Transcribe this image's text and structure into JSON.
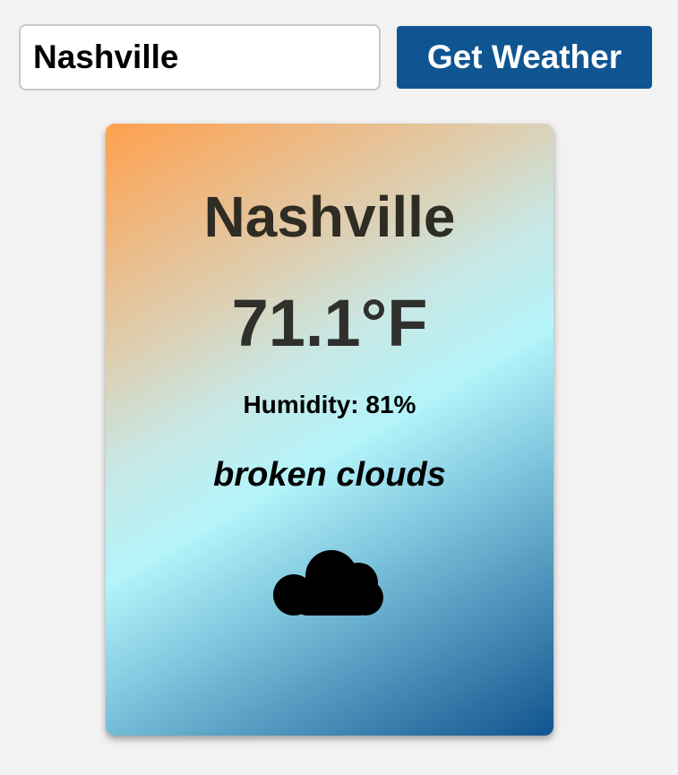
{
  "search": {
    "value": "Nashville",
    "button_label": "Get Weather"
  },
  "weather": {
    "city": "Nashville",
    "temperature": "71.1°F",
    "humidity": "Humidity: 81%",
    "description": "broken clouds",
    "icon": "cloud-icon"
  },
  "colors": {
    "button": "#0f5592",
    "gradient_start": "#ffa04e",
    "gradient_mid": "#b4f4fa",
    "gradient_end": "#11548f",
    "page_background": "#f2f2f2"
  }
}
